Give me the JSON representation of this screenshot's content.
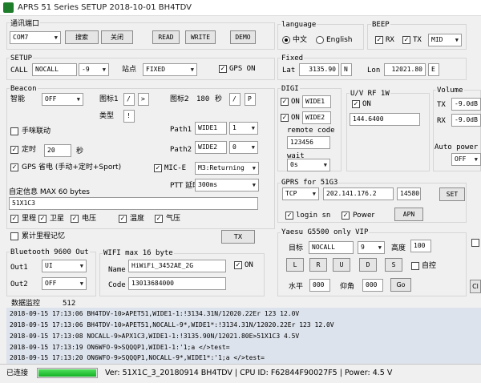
{
  "window": {
    "title": "APRS    51 Series SETUP 2018-10-01 BH4TDV",
    "app_icon": "app-icon"
  },
  "port": {
    "group_label": "通讯端口",
    "selected": "COM7",
    "search_label": "搜索",
    "close_label": "关闭",
    "read_label": "READ",
    "write_label": "WRITE",
    "demo_label": "DEMO"
  },
  "language": {
    "group_label": "language",
    "chinese": "中文",
    "english": "English",
    "selected": "chinese"
  },
  "beep": {
    "group_label": "BEEP",
    "rx": "RX",
    "tx": "TX",
    "rx_checked": true,
    "tx_checked": true,
    "level": "MID"
  },
  "setup": {
    "group_label": "SETUP",
    "call_label": "CALL",
    "call": "NOCALL",
    "ssid": "-9",
    "station_label": "站点",
    "station": "FIXED",
    "gps_on_label": "GPS ON",
    "gps_on": true
  },
  "fixed": {
    "group_label": "Fixed",
    "lat_label": "Lat",
    "lat": "3135.90",
    "lat_dir": "N",
    "lon_label": "Lon",
    "lon": "12021.80",
    "lon_dir": "E"
  },
  "beacon": {
    "group_label": "Beacon",
    "smart_label": "智能",
    "smart": "OFF",
    "icon1_label": "图标1",
    "icon1_a": "/",
    "icon1_b": ">",
    "icon2_label": "图标2",
    "icon2_val": "180",
    "icon2_unit": "秒",
    "icon2_a": "/",
    "icon2_b": "P",
    "type_label": "类型",
    "type_val": "!",
    "manual_label": "手咪联动",
    "manual": false,
    "path1_label": "Path1",
    "path1": "WIDE1",
    "path1_n": "1",
    "timer_label": "定时",
    "timer": true,
    "timer_val": "20",
    "timer_unit": "秒",
    "path2_label": "Path2",
    "path2": "WIDE2",
    "path2_n": "0",
    "gps_save_label": "GPS 省电 (手动+定时+Sport)",
    "gps_save": true,
    "mice_label": "MIC-E",
    "mice": true,
    "mice_val": "M3:Returning",
    "ptt_label": "PTT 延时",
    "ptt_val": "300ms"
  },
  "info": {
    "label": "自定信息 MAX 60 bytes",
    "text": "51X1C3",
    "mileage": "里程",
    "satellite": "卫星",
    "voltage": "电压",
    "temperature": "温度",
    "pressure": "气压",
    "accum_label": "累计里程记忆",
    "tx_label": "TX"
  },
  "digi": {
    "group_label": "DIGI",
    "on1": "ON",
    "wide1": "WIDE1",
    "on2": "ON",
    "wide2": "WIDE2",
    "remote_label": "remote code",
    "remote": "123456",
    "wait_label": "wait",
    "wait": "0s"
  },
  "uv": {
    "group_label": "U/V RF 1W",
    "on": "ON",
    "freq": "144.6400"
  },
  "volume": {
    "group_label": "Volume",
    "tx_label": "TX",
    "tx": "-9.0dB",
    "rx_label": "RX",
    "rx": "-9.0dB",
    "auto_label": "Auto power o",
    "auto": "OFF"
  },
  "gprs": {
    "group_label": "GPRS for 51G3",
    "proto": "TCP",
    "ip": "202.141.176.2",
    "port": "14580",
    "set_label": "SET",
    "login_label": "login sn",
    "power_label": "Power",
    "apn_label": "APN"
  },
  "yaesu": {
    "group_label": "Yaesu G5500    only VIP",
    "target_label": "目标",
    "target": "NOCALL",
    "target_n": "9",
    "height_label": "高度",
    "height": "100",
    "l": "L",
    "r": "R",
    "u": "U",
    "d": "D",
    "s": "S",
    "auto_label": "自控",
    "horizontal_label": "水平",
    "horizontal": "000",
    "elevation_label": "仰角",
    "elevation": "000",
    "go_label": "Go",
    "cl_label": "Cl"
  },
  "bluetooth": {
    "group_label": "Bluetooth  9600 Out",
    "out1_label": "Out1",
    "out1": "UI",
    "out2_label": "Out2",
    "out2": "OFF"
  },
  "wifi": {
    "group_label": "WIFI max 16 byte",
    "name_label": "Name",
    "name": "HiWiFi_3452AE_2G",
    "code_label": "Code",
    "code": "13013684000",
    "on_label": "ON"
  },
  "monitor": {
    "label": "数据监控",
    "count": "512",
    "lines": [
      "2018-09-15 17:13:06  BH4TDV-10>APET51,WIDE1-1:!3134.31N/12020.22Er 123 12.0V",
      "2018-09-15 17:13:06  BH4TDV-10>APET51,NOCALL-9*,WIDE1*:!3134.31N/12020.22Er 123 12.0V",
      "2018-09-15 17:13:08  NOCALL-9>APX1C3,WIDE1-1:!3135.90N/12021.80E>51X1C3 4.5V",
      "2018-09-15 17:13:19  ON6WFO-9>SQQQP1,WIDE1-1:'1;a    </>test=",
      "2018-09-15 17:13:20  ON6WFO-9>SQQQP1,NOCALL-9*,WIDE1*:'1;a    </>test="
    ]
  },
  "status": {
    "connected": "已连接",
    "progress": 1.0,
    "ver": "Ver: 51X1C_3_20180914 BH4TDV | CPU ID: F62844F90027F5 | Power: 4.5 V"
  },
  "colors": {
    "log_bg": "#dde3ec",
    "progress": "#1fc030"
  }
}
